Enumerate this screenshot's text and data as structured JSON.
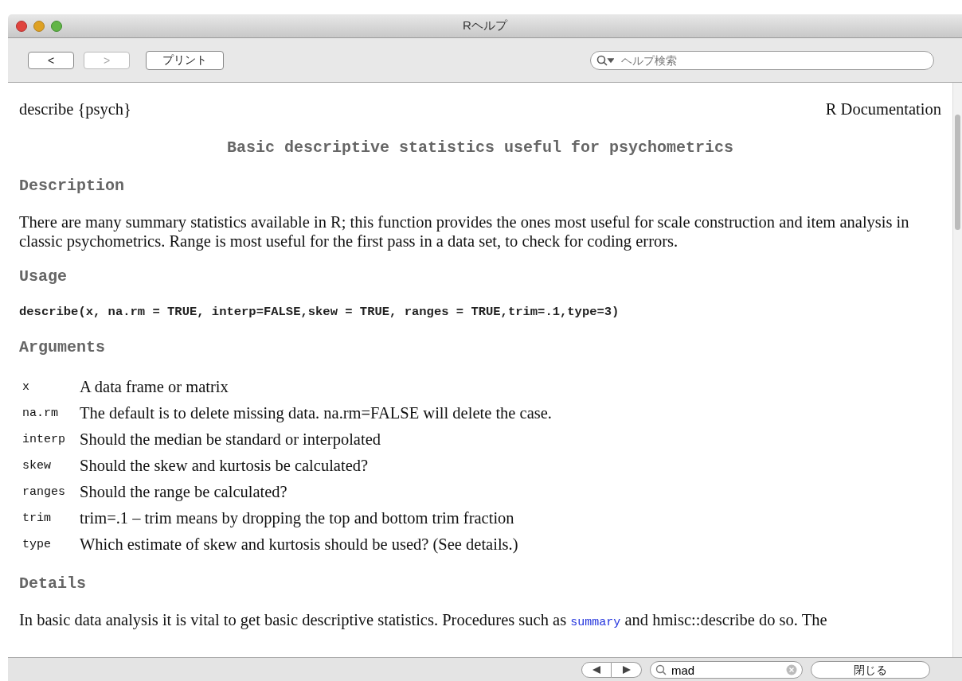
{
  "window": {
    "title": "Rヘルプ"
  },
  "toolbar": {
    "back": {
      "label": "<",
      "disabled": false
    },
    "forward": {
      "label": ">",
      "disabled": true
    },
    "print": "プリント",
    "search": {
      "placeholder": "ヘルプ検索"
    }
  },
  "doc": {
    "name": "describe {psych}",
    "source": "R Documentation",
    "title": "Basic descriptive statistics useful for psychometrics",
    "sections": [
      {
        "kind": "text",
        "heading": "Description",
        "text": "There are many summary statistics available in R; this function provides the ones most useful for scale construction and item analysis in classic psychometrics. Range is most useful for the first pass in a data set, to check for coding errors."
      },
      {
        "kind": "code",
        "heading": "Usage",
        "text": "describe(x, na.rm = TRUE, interp=FALSE,skew = TRUE, ranges = TRUE,trim=.1,type=3)"
      },
      {
        "kind": "args",
        "heading": "Arguments",
        "items": [
          {
            "name": "x",
            "text": "A data frame or matrix"
          },
          {
            "name": "na.rm",
            "text": "The default is to delete missing data. na.rm=FALSE will delete the case."
          },
          {
            "name": "interp",
            "text": "Should the median be standard or interpolated"
          },
          {
            "name": "skew",
            "text": "Should the skew and kurtosis be calculated?"
          },
          {
            "name": "ranges",
            "text": "Should the range be calculated?"
          },
          {
            "name": "trim",
            "text": "trim=.1 – trim means by dropping the top and bottom trim fraction"
          },
          {
            "name": "type",
            "text": "Which estimate of skew and kurtosis should be used? (See details.)"
          }
        ]
      },
      {
        "kind": "link_text",
        "heading": "Details",
        "before": "In basic data analysis it is vital to get basic descriptive statistics. Procedures such as",
        "link": "summary",
        "after": "and hmisc::describe do so. The"
      }
    ]
  },
  "find_bar": {
    "query": "mad",
    "close": "閉じる"
  }
}
